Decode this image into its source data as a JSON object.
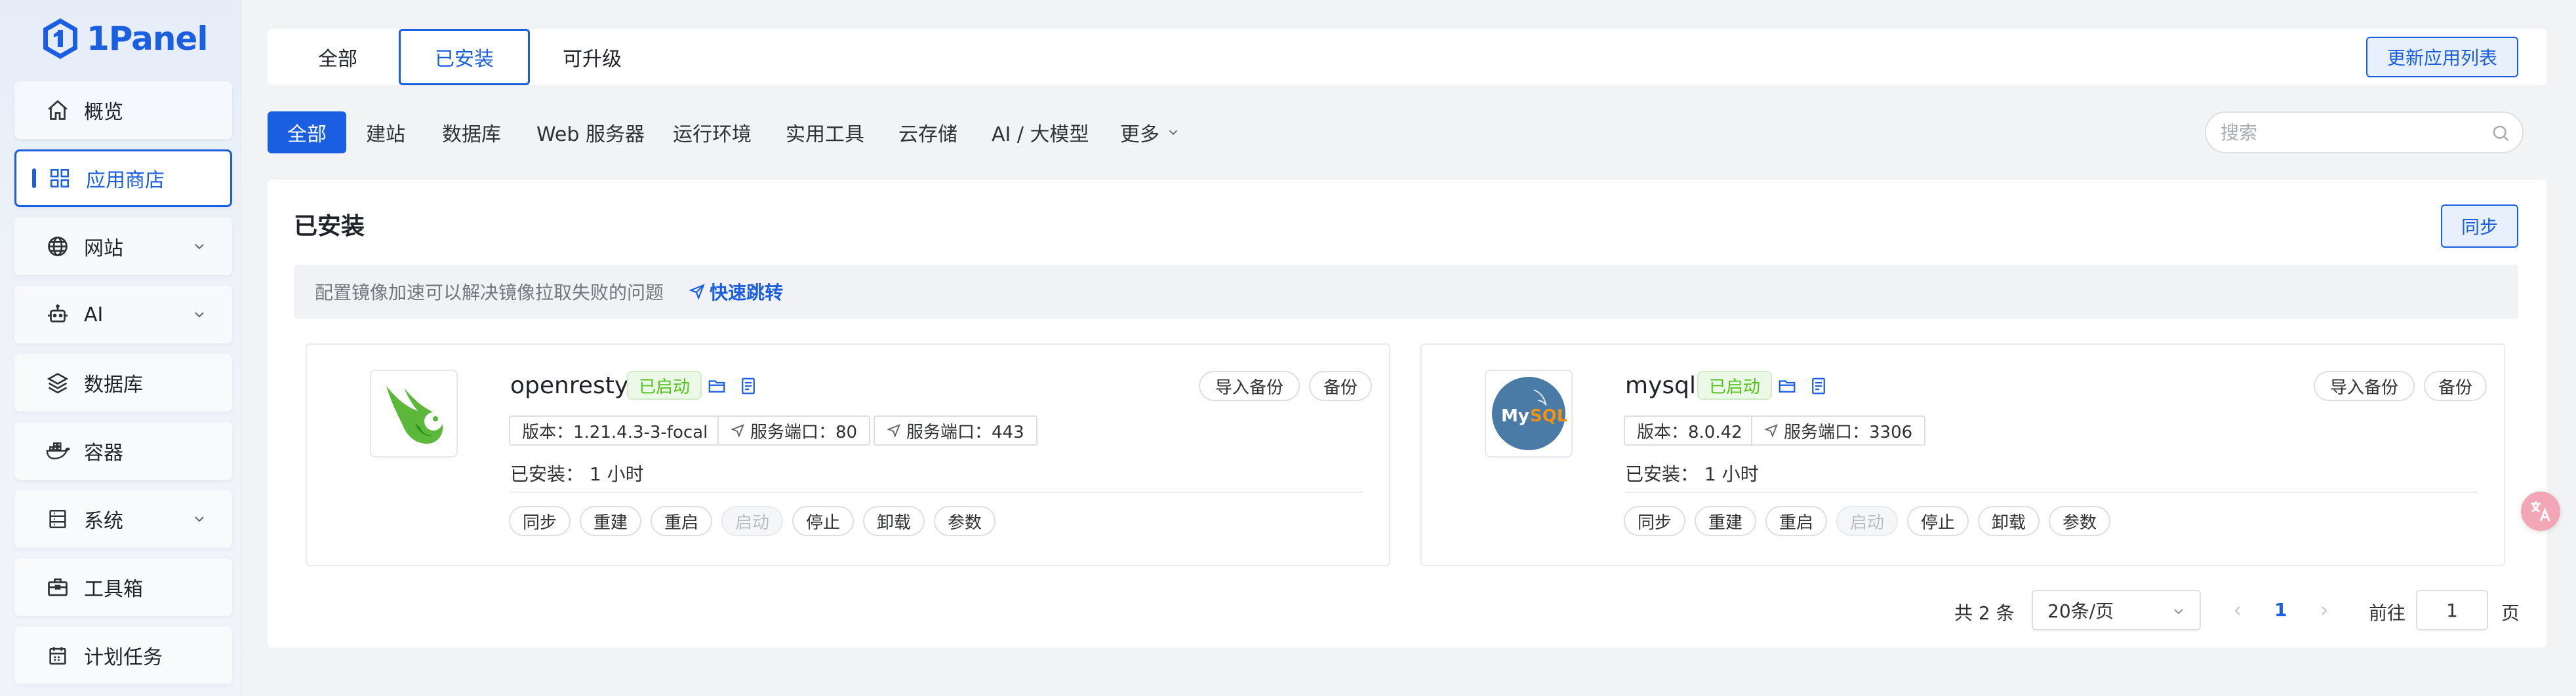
{
  "brand": {
    "name": "1Panel",
    "color": "#1a5ee1"
  },
  "sidebar": {
    "items": [
      {
        "label": "概览",
        "icon": "home-icon"
      },
      {
        "label": "应用商店",
        "icon": "grid-icon",
        "active": true
      },
      {
        "label": "网站",
        "icon": "globe-icon",
        "expandable": true
      },
      {
        "label": "AI",
        "icon": "robot-icon",
        "expandable": true
      },
      {
        "label": "数据库",
        "icon": "layers-icon"
      },
      {
        "label": "容器",
        "icon": "docker-icon"
      },
      {
        "label": "系统",
        "icon": "server-icon",
        "expandable": true
      },
      {
        "label": "工具箱",
        "icon": "toolbox-icon"
      },
      {
        "label": "计划任务",
        "icon": "calendar-icon"
      }
    ]
  },
  "top_tabs": {
    "tabs": [
      "全部",
      "已安装",
      "可升级"
    ],
    "active": "已安装",
    "update_button": "更新应用列表"
  },
  "categories": {
    "items": [
      "全部",
      "建站",
      "数据库",
      "Web 服务器",
      "运行环境",
      "实用工具",
      "云存储",
      "AI / 大模型"
    ],
    "more": "更多",
    "active": "全部"
  },
  "search": {
    "placeholder": "搜索",
    "value": ""
  },
  "panel": {
    "title": "已安装",
    "sync_button": "同步",
    "notice": "配置镜像加速可以解决镜像拉取失败的问题",
    "notice_link": "快速跳转"
  },
  "apps": [
    {
      "name": "openresty",
      "status": "已启动",
      "version": "版本：1.21.4.3-3-focal",
      "ports": [
        "服务端口：80",
        "服务端口：443"
      ],
      "installed": "已安装：  1 小时",
      "top_actions": [
        "导入备份",
        "备份"
      ],
      "actions": [
        "同步",
        "重建",
        "重启",
        "启动",
        "停止",
        "卸载",
        "参数"
      ],
      "disabled_action": "启动"
    },
    {
      "name": "mysql",
      "status": "已启动",
      "version": "版本：8.0.42",
      "ports": [
        "服务端口：3306"
      ],
      "installed": "已安装：  1 小时",
      "top_actions": [
        "导入备份",
        "备份"
      ],
      "actions": [
        "同步",
        "重建",
        "重启",
        "启动",
        "停止",
        "卸载",
        "参数"
      ],
      "disabled_action": "启动",
      "logo_text": {
        "my": "My",
        "sql": "SQL"
      }
    }
  ],
  "pagination": {
    "total": "共 2 条",
    "page_size": "20条/页",
    "current_page": "1",
    "goto_label": "前往",
    "goto_value": "1",
    "page_suffix": "页"
  },
  "colors": {
    "accent": "#1a5ee1",
    "running_green": "#52c41a",
    "translate_button": "#f2a7b7"
  }
}
